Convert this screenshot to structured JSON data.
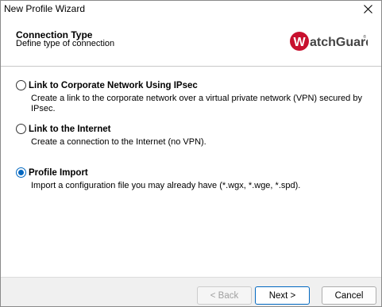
{
  "window": {
    "title": "New Profile Wizard"
  },
  "header": {
    "title": "Connection Type",
    "subtitle": "Define type of connection",
    "logo_text": "WatchGuard",
    "logo_color": "#c8102e"
  },
  "options": [
    {
      "label": "Link to Corporate Network Using IPsec",
      "description": "Create a link to the corporate network over a virtual private network (VPN) secured by IPsec.",
      "selected": false
    },
    {
      "label": "Link to the Internet",
      "description": "Create a connection to the Internet (no VPN).",
      "selected": false
    },
    {
      "label": "Profile Import",
      "description": "Import a configuration file you may already have (*.wgx, *.wge, *.spd).",
      "selected": true
    }
  ],
  "footer": {
    "back_label": "< Back",
    "next_label": "Next >",
    "cancel_label": "Cancel"
  },
  "colors": {
    "accent": "#0067c0",
    "brand_red": "#c8102e"
  }
}
